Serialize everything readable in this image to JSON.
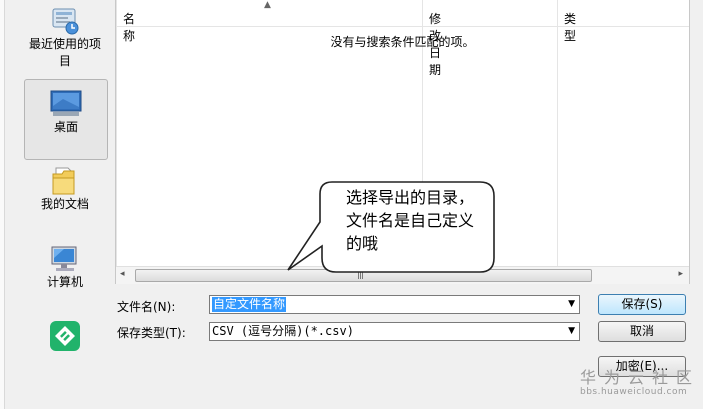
{
  "places": {
    "items": [
      {
        "label_line1": "最近使用的项",
        "label_line2": "目",
        "icon": "recent-items-icon"
      },
      {
        "label": "桌面",
        "icon": "desktop-icon",
        "selected": true
      },
      {
        "label": "我的文档",
        "icon": "documents-folder-icon"
      },
      {
        "label": "计算机",
        "icon": "computer-icon"
      },
      {
        "icon": "app-logo-icon"
      }
    ]
  },
  "file_list": {
    "columns": [
      "名称",
      "修改日期",
      "类型"
    ],
    "empty_message": "没有与搜索条件匹配的项。"
  },
  "callout": {
    "lines": [
      "选择导出的目录，",
      "文件名是自己定义",
      "的哦"
    ]
  },
  "form": {
    "filename_label": "文件名(N):",
    "filename_value": "自定文件名称",
    "filetype_label": "保存类型(T):",
    "filetype_value": "CSV (逗号分隔)(*.csv)"
  },
  "buttons": {
    "save": "保存(S)",
    "cancel": "取消",
    "encrypt": "加密(E)..."
  },
  "watermark": {
    "title": "华为云社区",
    "url": "bbs.huaweicloud.com"
  },
  "colors": {
    "selection": "#3399ff",
    "primary_button": "#bee6fd"
  }
}
